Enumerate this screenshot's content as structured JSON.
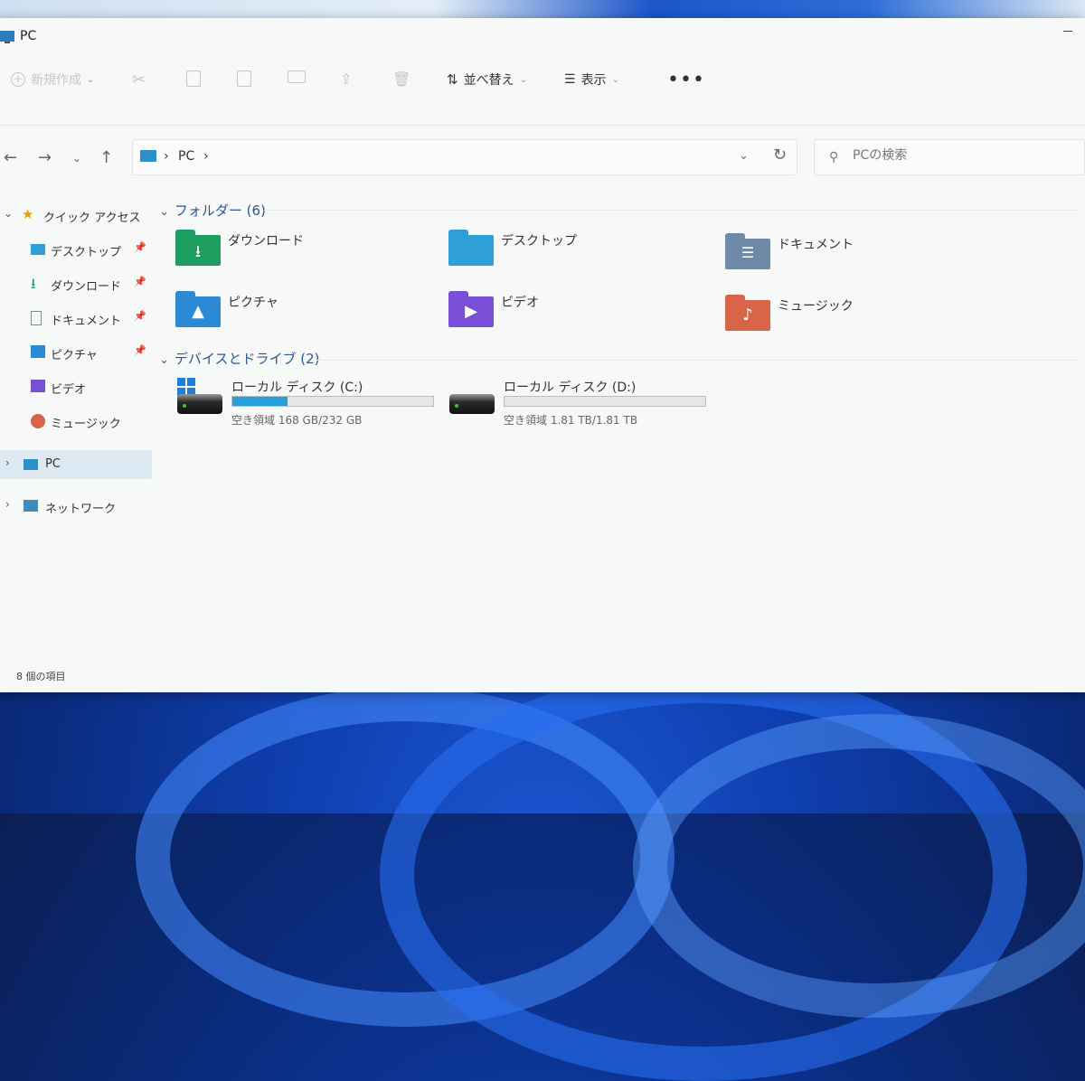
{
  "window": {
    "title": "PC"
  },
  "toolbar": {
    "new_label": "新規作成",
    "sort_label": "並べ替え",
    "view_label": "表示",
    "more_label": "•••"
  },
  "nav": {
    "breadcrumb": [
      "PC"
    ],
    "search_placeholder": "PCの検索"
  },
  "sidebar": {
    "quick_access": "クイック アクセス",
    "items": [
      {
        "label": "デスクトップ",
        "icon": "desktop-icon"
      },
      {
        "label": "ダウンロード",
        "icon": "download-icon"
      },
      {
        "label": "ドキュメント",
        "icon": "documents-icon"
      },
      {
        "label": "ピクチャ",
        "icon": "pictures-icon"
      },
      {
        "label": "ビデオ",
        "icon": "videos-icon"
      },
      {
        "label": "ミュージック",
        "icon": "music-icon"
      }
    ],
    "pc": "PC",
    "network": "ネットワーク"
  },
  "main": {
    "folders_header": "フォルダー (6)",
    "folders": [
      {
        "name": "ダウンロード",
        "color": "#1e9e5e"
      },
      {
        "name": "デスクトップ",
        "color": "#2e9fd8"
      },
      {
        "name": "ドキュメント",
        "color": "#6f8aa8"
      },
      {
        "name": "ピクチャ",
        "color": "#2a8ad6"
      },
      {
        "name": "ビデオ",
        "color": "#7a4fd8"
      },
      {
        "name": "ミュージック",
        "color": "#d8644a"
      }
    ],
    "drives_header": "デバイスとドライブ (2)",
    "drives": [
      {
        "name": "ローカル ディスク (C:)",
        "free": "空き領域 168 GB/232 GB",
        "used_fraction": 0.276
      },
      {
        "name": "ローカル ディスク (D:)",
        "free": "空き領域 1.81 TB/1.81 TB",
        "used_fraction": 0.0
      }
    ]
  },
  "status": {
    "items": "8 個の項目"
  },
  "colors": {
    "accent": "#26a0da",
    "selection": "#dde9f3"
  }
}
